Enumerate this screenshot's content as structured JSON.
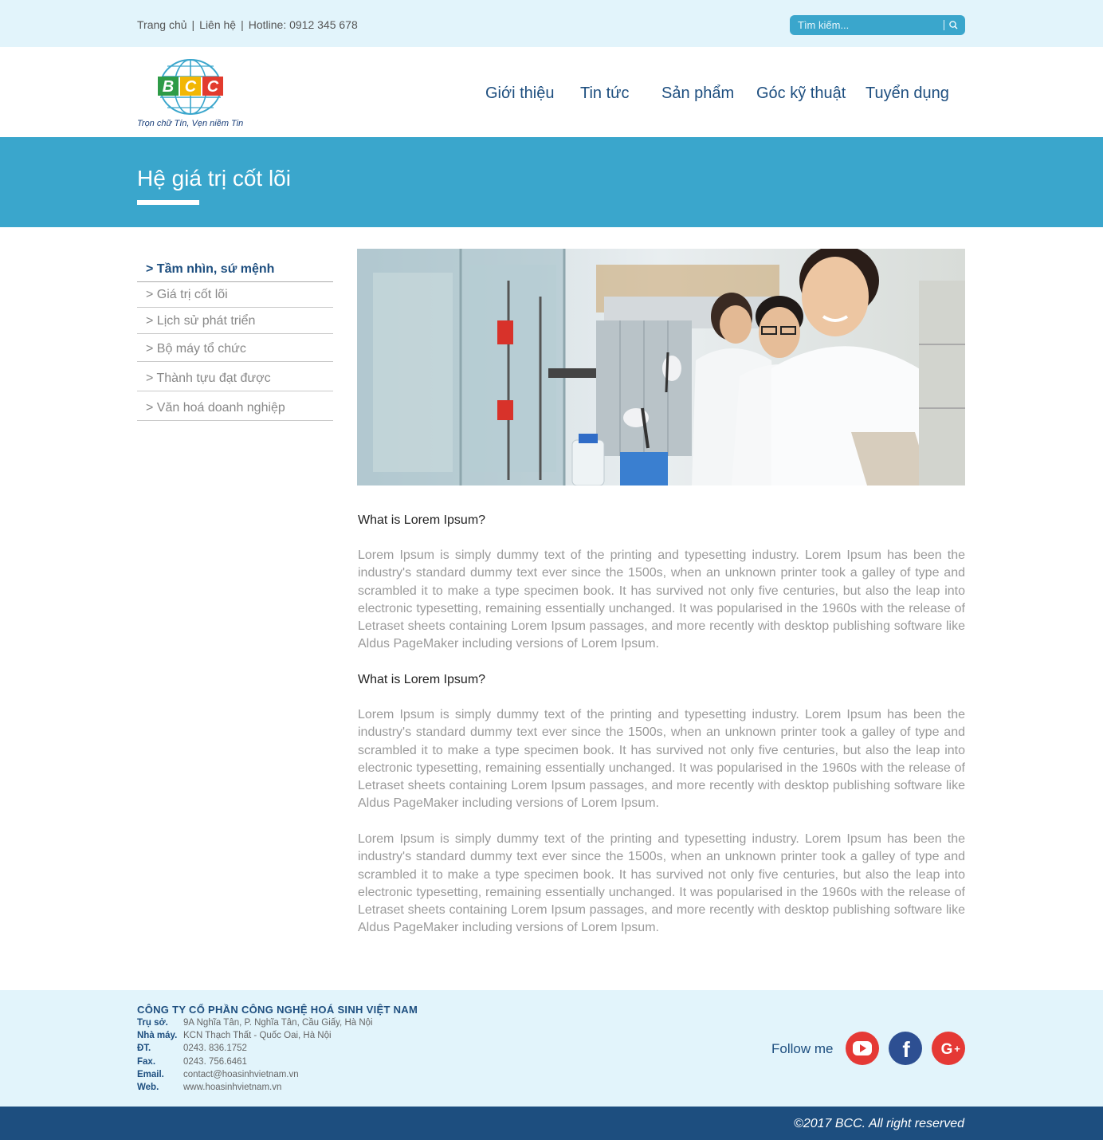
{
  "topbar": {
    "links": [
      "Trang chủ",
      "Liên hệ",
      "Hotline: 0912 345 678"
    ],
    "search_placeholder": "Tìm kiếm..."
  },
  "header": {
    "logo_text": "BCC",
    "tagline": "Trọn chữ Tín, Vẹn niềm Tin",
    "nav": [
      "Giới thiệu",
      "Tin tức",
      "Sản phẩm",
      "Góc kỹ thuật",
      "Tuyển dụng"
    ]
  },
  "banner": {
    "title": "Hệ giá trị cốt lõi"
  },
  "sidebar": {
    "items": [
      "> Tầm nhìn, sứ mệnh",
      "> Giá trị cốt lõi",
      "> Lịch sử phát triển",
      "> Bộ máy tổ chức",
      "> Thành tựu đạt được",
      "> Văn hoá doanh nghiệp"
    ],
    "active_index": 0
  },
  "content": {
    "heading1": "What is Lorem Ipsum?",
    "para1": "Lorem Ipsum is simply dummy text of the printing and typesetting industry. Lorem Ipsum has been the industry's standard dummy text ever since the 1500s, when an unknown printer took a galley of type and scrambled it to make a type specimen book. It has survived not only five centuries, but also the leap into electronic typesetting, remaining essentially unchanged. It was popularised in the 1960s with the release of Letraset sheets containing Lorem Ipsum passages, and more recently with desktop publishing software like Aldus PageMaker including versions of Lorem Ipsum.",
    "heading2": "What is Lorem Ipsum?",
    "para2": "Lorem Ipsum is simply dummy text of the printing and typesetting industry. Lorem Ipsum has been the industry's standard dummy text ever since the 1500s, when an unknown printer took a galley of type and scrambled it to make a type specimen book. It has survived not only five centuries, but also the leap into electronic typesetting, remaining essentially unchanged. It was popularised in the 1960s with the release of Letraset sheets containing Lorem Ipsum passages, and more recently with desktop publishing software like Aldus PageMaker including versions of Lorem Ipsum.",
    "para3": "Lorem Ipsum is simply dummy text of the printing and typesetting industry. Lorem Ipsum has been the industry's standard dummy text ever since the 1500s, when an unknown printer took a galley of type and scrambled it to make a type specimen book. It has survived not only five centuries, but also the leap into electronic typesetting, remaining essentially unchanged. It was popularised in the 1960s with the release of Letraset sheets containing Lorem Ipsum passages, and more recently with desktop publishing software like Aldus PageMaker including versions of Lorem Ipsum."
  },
  "footer": {
    "company": "CÔNG TY CỔ PHẦN CÔNG NGHỆ HOÁ SINH VIỆT NAM",
    "rows": [
      {
        "label": "Trụ sở.",
        "value": "9A Nghĩa Tân, P. Nghĩa Tân, Cầu Giấy, Hà Nội"
      },
      {
        "label": "Nhà máy.",
        "value": "KCN Thạch Thất - Quốc Oai, Hà Nội"
      },
      {
        "label": "ĐT.",
        "value": "0243. 836.1752"
      },
      {
        "label": "Fax.",
        "value": "0243. 756.6461"
      },
      {
        "label": "Email.",
        "value": "contact@hoasinhvietnam.vn"
      },
      {
        "label": "Web.",
        "value": "www.hoasinhvietnam.vn"
      }
    ],
    "follow_label": "Follow me",
    "social": [
      "youtube-icon",
      "facebook-icon",
      "google-plus-icon"
    ],
    "copyright": "©2017 BCC. All right reserved"
  },
  "colors": {
    "light_bg": "#e2f4fb",
    "accent_blue": "#3aa6cc",
    "navy": "#1d4e7f",
    "youtube_red": "#e53935",
    "facebook_blue": "#2d4f92",
    "google_red": "#e53935"
  }
}
